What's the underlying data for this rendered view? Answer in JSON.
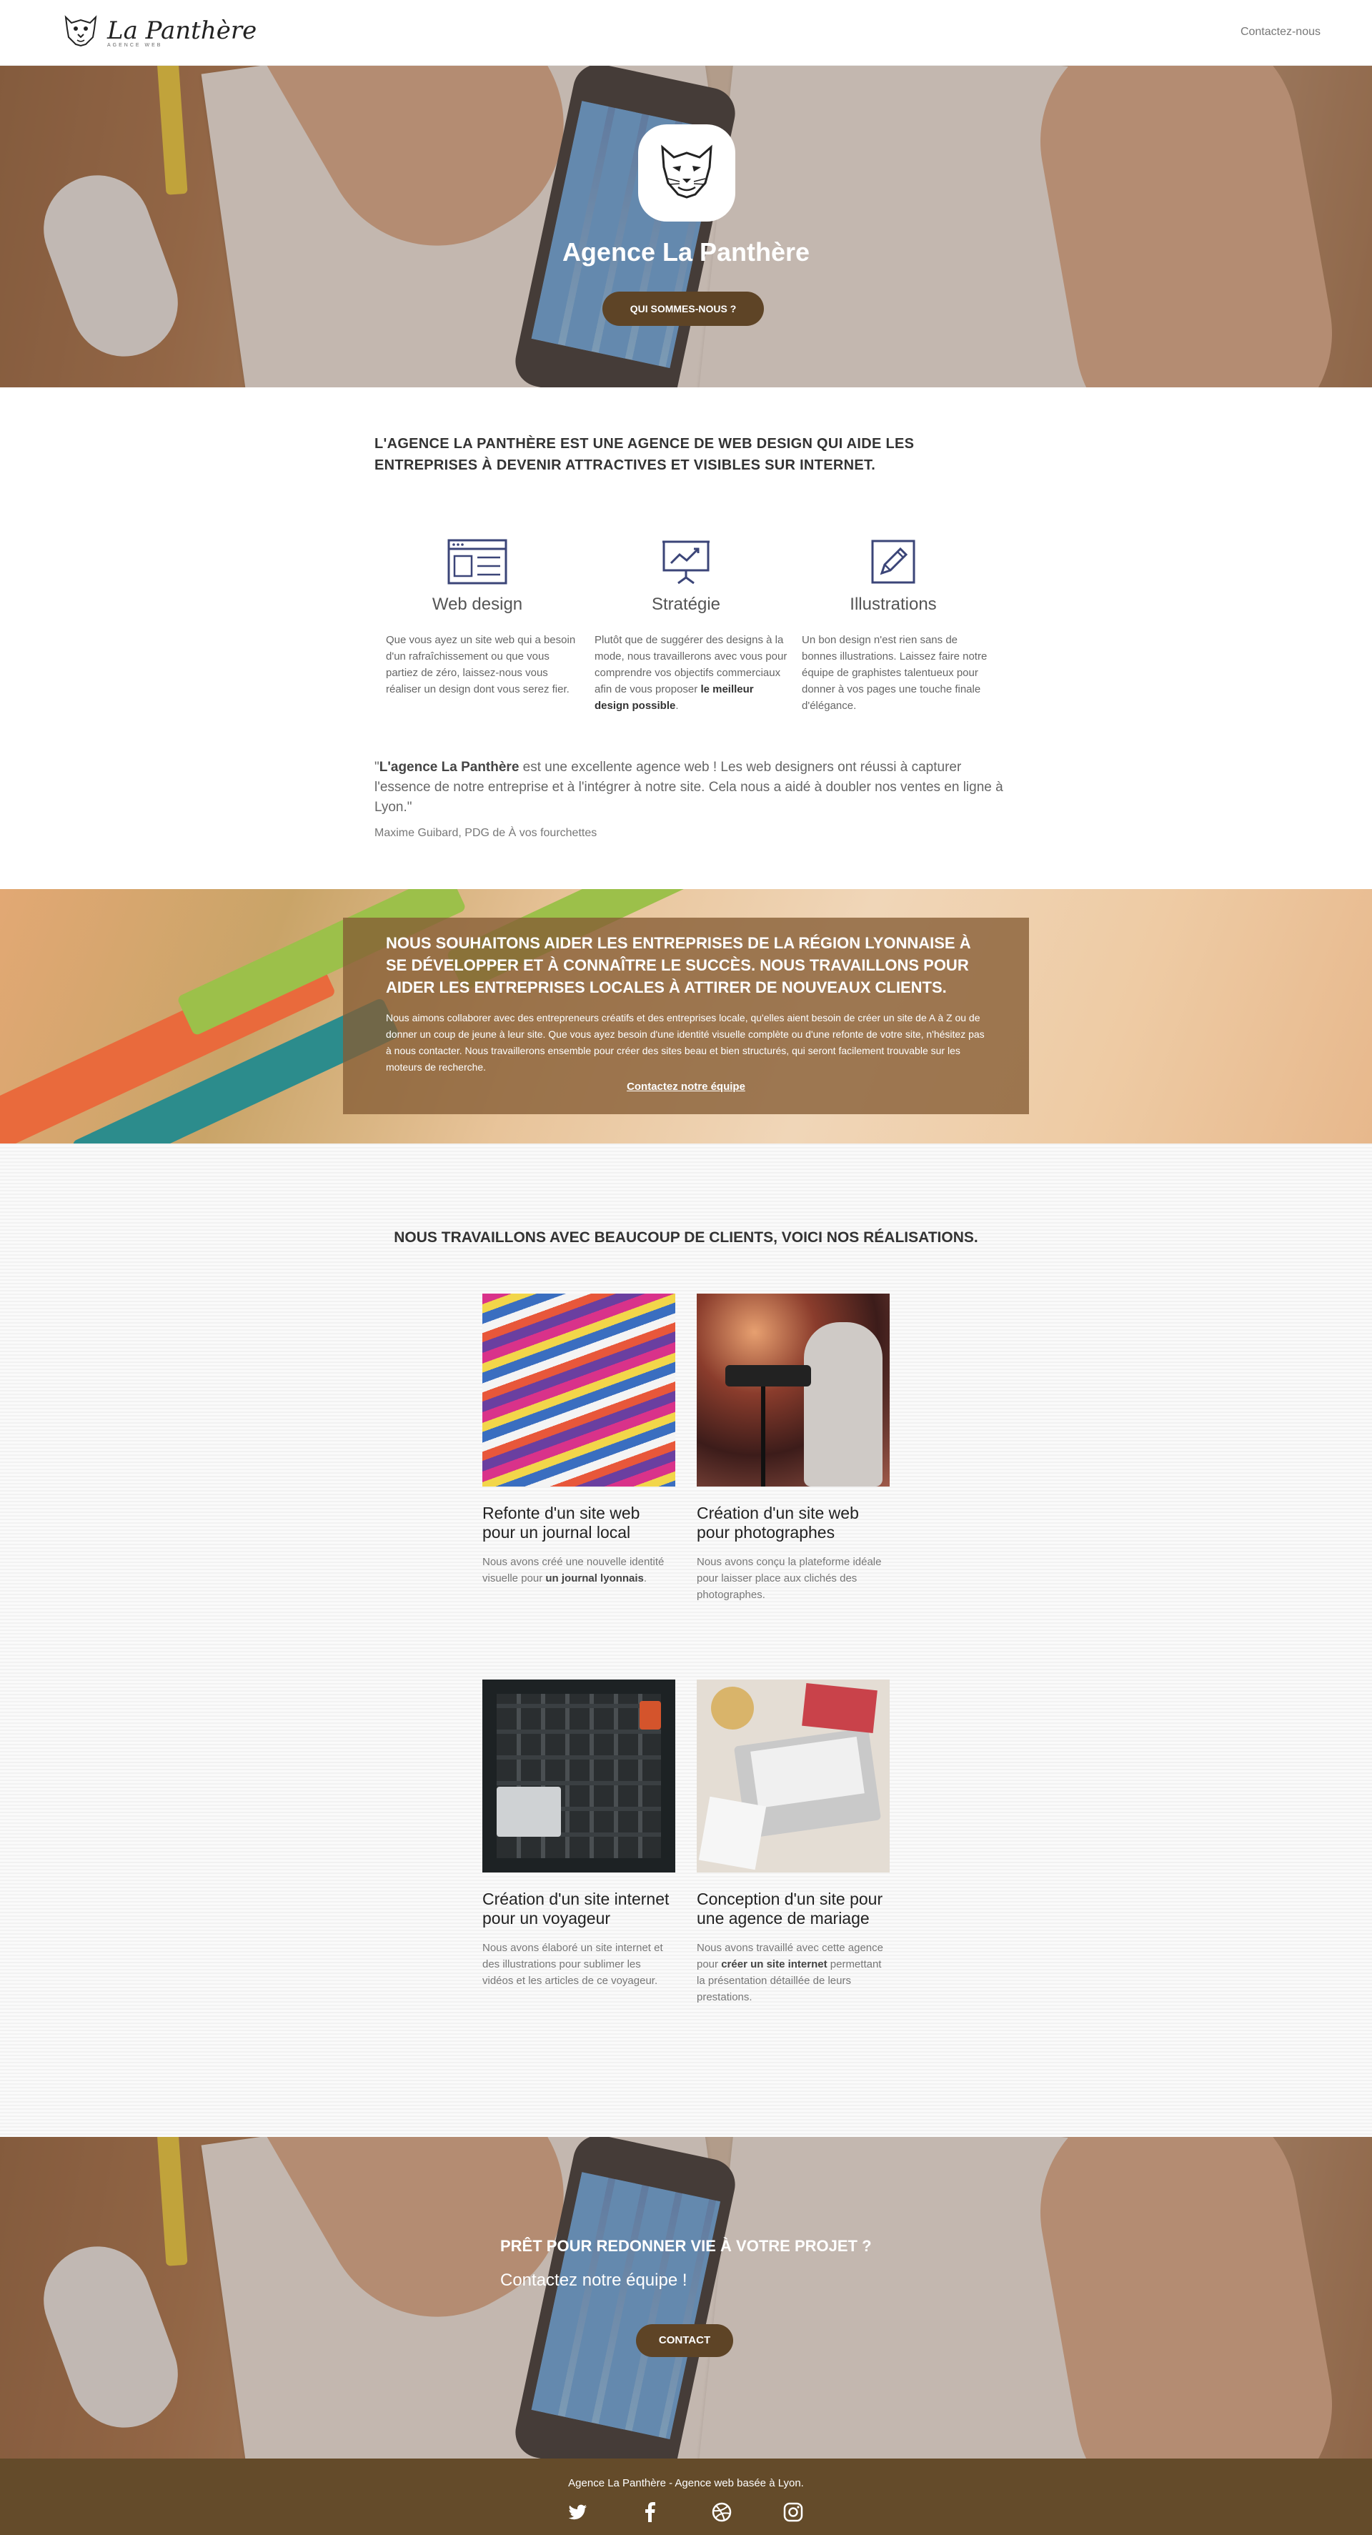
{
  "header": {
    "logo_text": "La Panthère",
    "logo_tagline": "AGENCE WEB",
    "nav_contact": "Contactez-nous"
  },
  "hero": {
    "title": "Agence La Panthère",
    "button": "QUI SOMMES-NOUS ?"
  },
  "intro": {
    "heading_line1": "L'AGENCE LA PANTHÈRE EST UNE AGENCE DE WEB DESIGN QUI AIDE LES",
    "heading_line2": "ENTREPRISES À DEVENIR ATTRACTIVES ET VISIBLES SUR INTERNET."
  },
  "services": [
    {
      "title": "Web design",
      "icon": "webpage-layout-icon",
      "text": "Que vous ayez un site web qui a besoin d'un rafraîchissement ou que vous partiez de zéro, laissez-nous vous réaliser un design dont vous serez fier."
    },
    {
      "title": "Stratégie",
      "icon": "presentation-chart-icon",
      "text_before": "Plutôt que de suggérer des designs à la mode, nous travaillerons avec vous pour comprendre vos objectifs commerciaux afin de vous proposer ",
      "text_bold": "le meilleur design possible",
      "text_after": "."
    },
    {
      "title": "Illustrations",
      "icon": "pencil-drawing-icon",
      "text": "Un bon design n'est rien sans de bonnes illustrations. Laissez faire notre équipe de graphistes talentueux pour donner à vos pages une touche finale d'élégance."
    }
  ],
  "testimonial": {
    "open_quote": "\"",
    "company": "L'agence La Panthère",
    "text": " est une excellente agence web ! Les web designers ont réussi à capturer l'essence de notre entreprise et à l'intégrer à notre site. Cela nous a aidé à doubler nos ventes en ligne à Lyon.\"",
    "author": "Maxime Guibard, PDG de À vos fourchettes"
  },
  "mission": {
    "heading": "NOUS SOUHAITONS AIDER LES ENTREPRISES DE LA RÉGION LYONNAISE À SE DÉVELOPPER ET À CONNAÎTRE LE SUCCÈS. NOUS TRAVAILLONS POUR AIDER LES ENTREPRISES LOCALES À ATTIRER DE NOUVEAUX CLIENTS.",
    "text": "Nous aimons collaborer avec des entrepreneurs créatifs et des entreprises locale, qu'elles aient besoin de créer un site de A à Z ou de donner un coup de jeune à leur site. Que vous ayez besoin d'une identité visuelle complète ou d'une refonte de votre site, n'hésitez pas à nous contacter. Nous travaillerons ensemble pour créer des sites beau et bien structurés, qui seront facilement trouvable sur les moteurs de recherche.",
    "link": "Contactez notre équipe"
  },
  "portfolio": {
    "heading": "NOUS TRAVAILLONS AVEC BEAUCOUP DE CLIENTS, VOICI NOS RÉALISATIONS.",
    "items": [
      {
        "title": "Refonte d'un site web pour un journal local",
        "text_before": "Nous avons créé une nouvelle identité visuelle pour ",
        "text_bold": "un journal lyonnais",
        "text_after": "."
      },
      {
        "title": "Création d'un site web pour photographes",
        "text_before": "Nous avons conçu la plateforme idéale pour laisser place aux clichés des photographes.",
        "text_bold": "",
        "text_after": ""
      },
      {
        "title": "Création d'un site internet pour un voyageur",
        "text_before": "Nous avons élaboré un site internet et des illustrations pour sublimer les vidéos et les articles de ce voyageur.",
        "text_bold": "",
        "text_after": ""
      },
      {
        "title": "Conception d'un site pour une agence de mariage",
        "text_before": "Nous avons travaillé avec cette agence pour ",
        "text_bold": "créer un site internet",
        "text_after": " permettant la présentation détaillée de leurs prestations."
      }
    ]
  },
  "cta": {
    "heading": "PRÊT POUR REDONNER VIE À VOTRE PROJET ?",
    "subheading": "Contactez notre équipe !",
    "button": "CONTACT"
  },
  "footer": {
    "text": "Agence La Panthère - Agence web basée à Lyon.",
    "social": [
      "twitter-icon",
      "facebook-icon",
      "dribbble-icon",
      "instagram-icon"
    ]
  },
  "colors": {
    "brand_brown": "#5e4426",
    "footer_brown": "#644b2a",
    "icon_navy": "#3b4578"
  }
}
